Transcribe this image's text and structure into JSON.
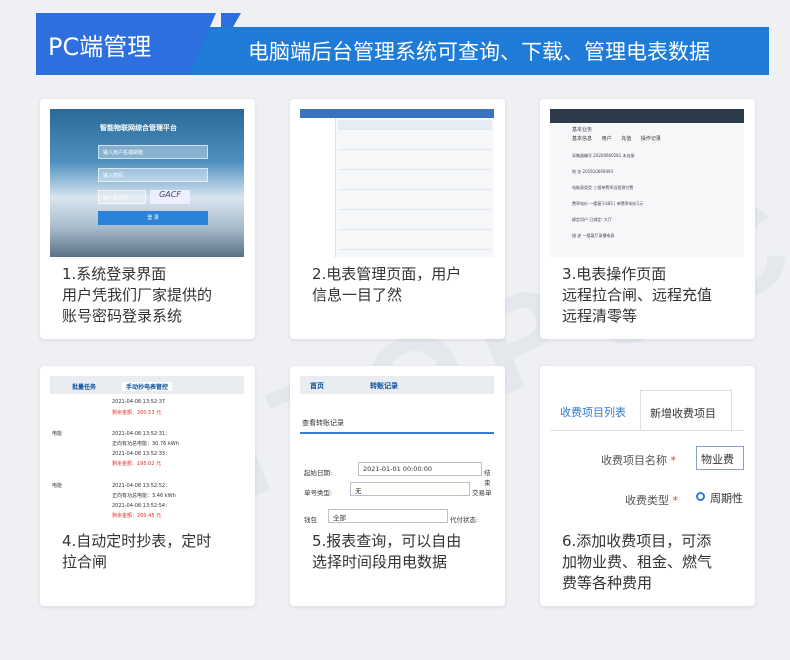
{
  "header": {
    "title": "PC端管理",
    "subtitle": "电脑端后台管理系统可查询、下载、管理电表数据"
  },
  "watermark": "CNTOPOC",
  "cards": [
    {
      "caption_lines": [
        "1.系统登录界面",
        "用户凭我们厂家提供的",
        "账号密码登录系统"
      ],
      "login": {
        "title": "智能物联网综合管理平台",
        "username_placeholder": "输入用户名或邮箱",
        "password_placeholder": "输入密码",
        "captcha_placeholder": "输入验证码",
        "captcha_code": "GACF",
        "login_button": "登 录"
      }
    },
    {
      "caption_lines": [
        "2.电表管理页面，用户",
        "信息一目了然"
      ]
    },
    {
      "caption_lines": [
        "3.电表操作页面",
        "远程拉合闸、远程充值",
        "远程清零等"
      ],
      "meter": {
        "panel_title": "基本业务",
        "tabs": [
          "基本信息",
          "用户",
          "充值",
          "操作记录"
        ],
        "lines": [
          "采集器编号  20200660281  未连接",
          "地  址  201910669493",
          "电能表类型  三相单费率远程预付费",
          "费率电价  一楼基于485 | 单费率电价1元",
          "绑定用户  已绑定: 大厅",
          "描  述  一楼展厅录播电表"
        ]
      }
    },
    {
      "caption_lines": [
        "4.自动定时抄表，定时",
        "拉合闸"
      ],
      "tabs": [
        "批量任务",
        "手动抄电表管控"
      ],
      "records": [
        {
          "label": "",
          "lines": [
            "2021-04-08 13:52:37",
            "剩余金额：200.53 元"
          ]
        },
        {
          "label": "电能",
          "lines": [
            "2021-04-08 13:52:31：",
            "正向有功总电能：30.76 kWh",
            "2021-04-08 13:52:33：",
            "剩余金额：195.02 元"
          ]
        },
        {
          "label": "电能",
          "lines": [
            "2021-04-08 13:52:52：",
            "正向有功总电能：3.46 kWh",
            "2021-04-08 13:52:54：",
            "剩余金额：200.45 元"
          ]
        }
      ]
    },
    {
      "caption_lines": [
        "5.报表查询，可以自由",
        "选择时间段用电数据"
      ],
      "tabs": [
        "首页",
        "转账记录"
      ],
      "subtab": "查看转账记录",
      "form": {
        "start_label": "起始日期:",
        "start_value": "2021-01-01 00:00:00",
        "end_label": "结束",
        "doc_type_label": "单号类型:",
        "doc_type_value": "无",
        "trade_label": "交易单",
        "wallet_label": "钱包",
        "wallet_value": "全部",
        "agent_label": "代付状态:"
      }
    },
    {
      "caption_lines": [
        "6.添加收费项目，可添",
        "加物业费、租金、燃气",
        "费等各种费用"
      ],
      "tabs": [
        "收费项目列表",
        "新增收费项目"
      ],
      "form": {
        "name_label": "收费项目名称",
        "name_value": "物业费",
        "type_label": "收费类型",
        "type_value": "周期性"
      }
    }
  ]
}
